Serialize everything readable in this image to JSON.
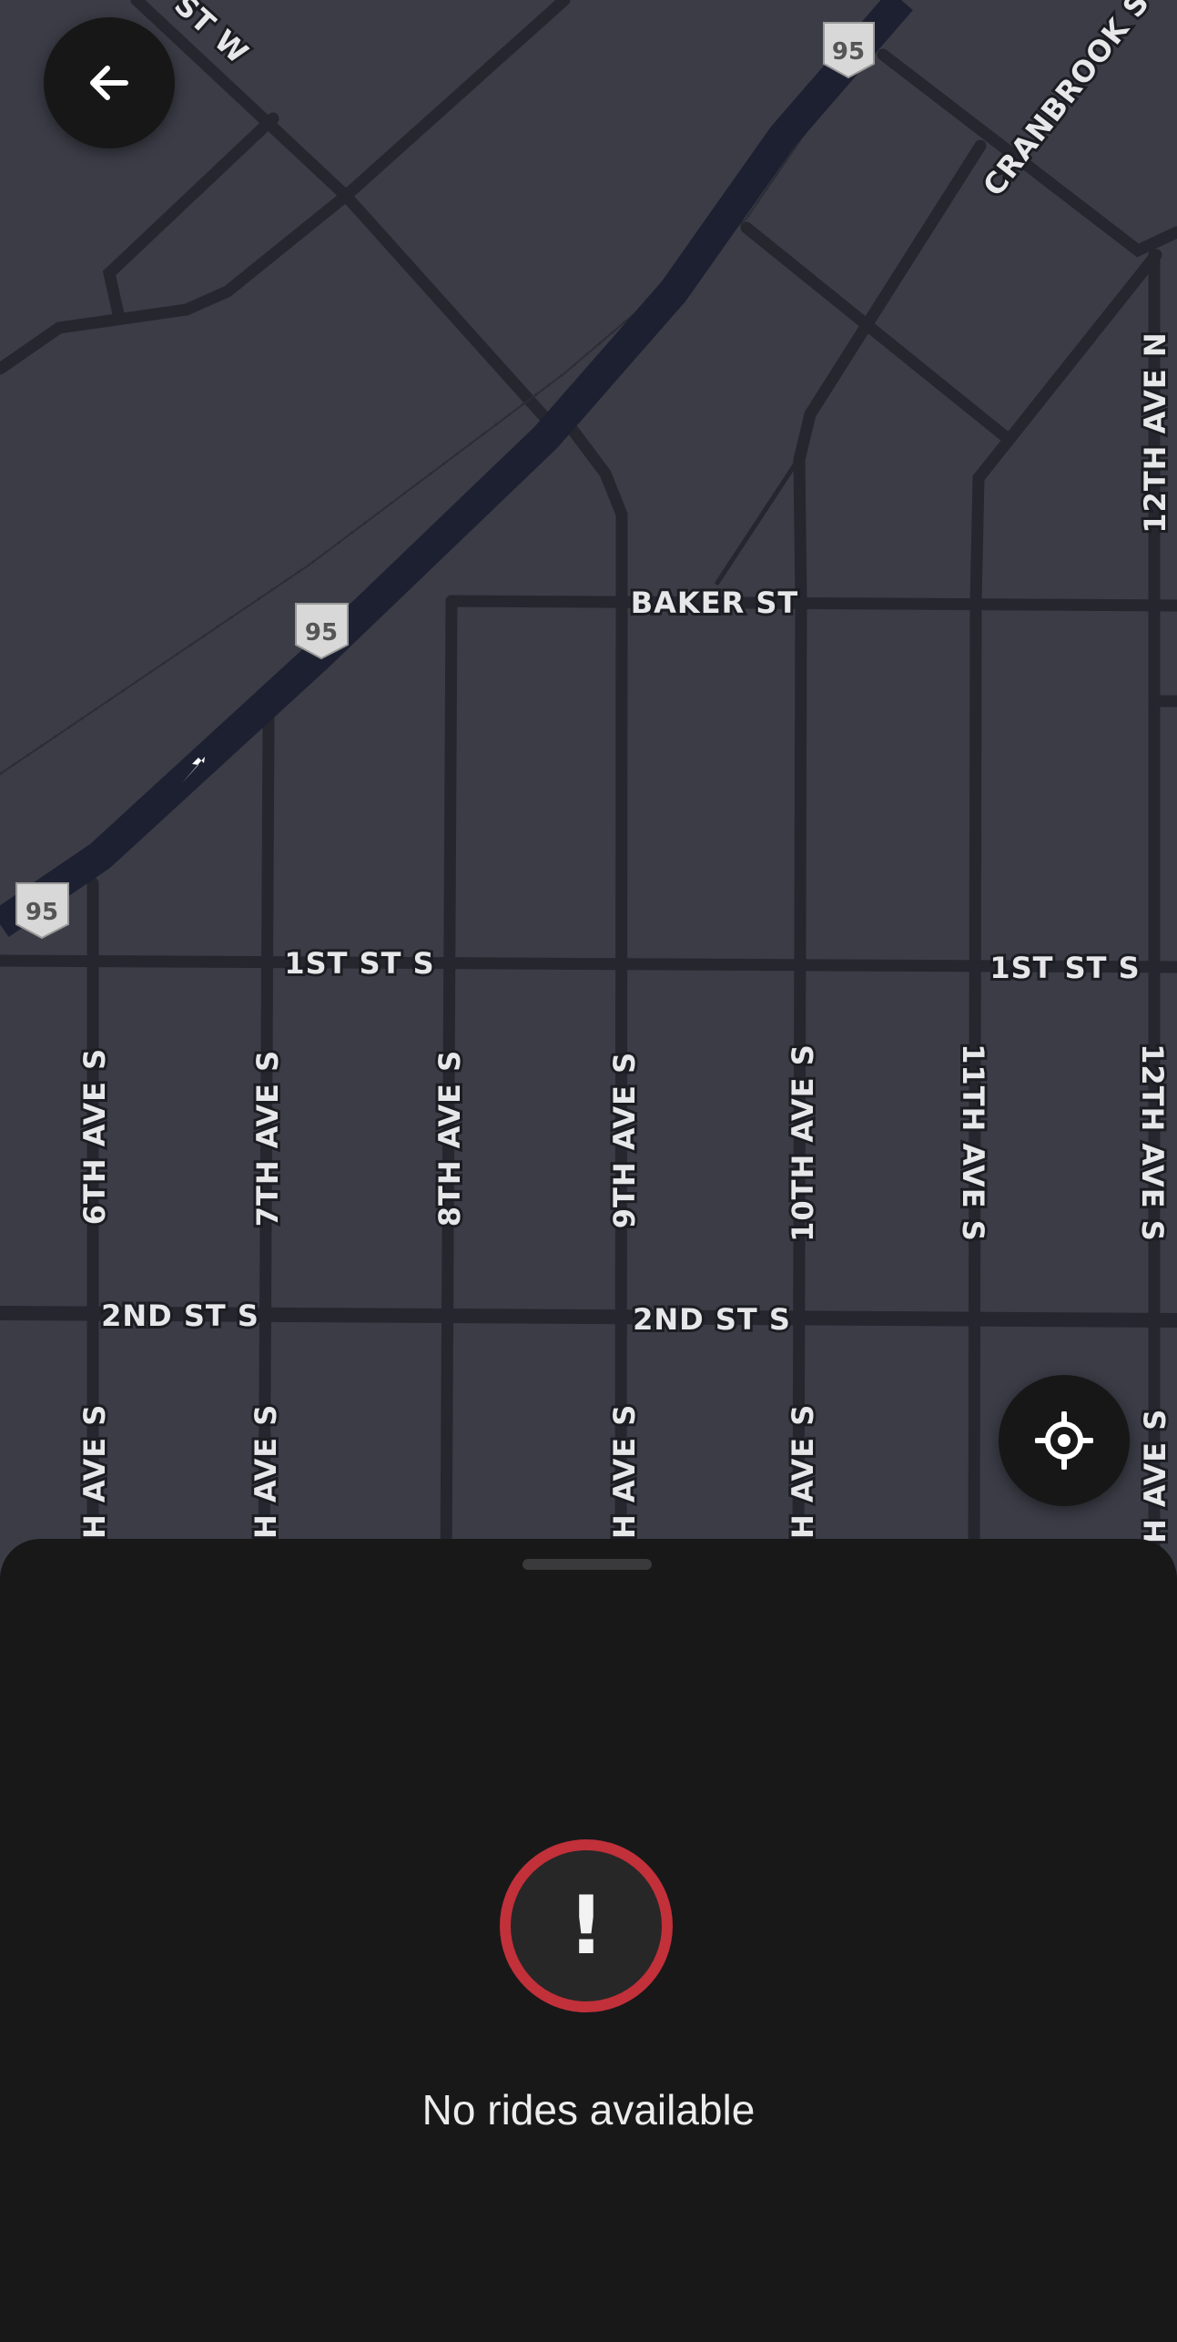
{
  "map": {
    "streets": {
      "st_w": "ST W",
      "cranbrook": "CRANBROOK S",
      "twelfth_ave_n": "12TH AVE N",
      "baker_st": "BAKER ST",
      "first_st_s_left": "1ST ST S",
      "first_st_s_right": "1ST ST S",
      "second_st_s_left": "2ND ST S",
      "second_st_s_right": "2ND ST S",
      "sixth_ave_s": "6TH AVE S",
      "seventh_ave_s": "7TH AVE S",
      "eighth_ave_s": "8TH AVE S",
      "ninth_ave_s": "9TH AVE S",
      "tenth_ave_s": "10TH AVE S",
      "eleventh_ave_s": "11TH AVE S",
      "twelfth_ave_s": "12TH AVE S",
      "lower_6": "H AVE S",
      "lower_7": "H AVE S",
      "lower_9": "H AVE S",
      "lower_10": "H AVE S",
      "lower_12": "H AVE S"
    },
    "highway_shields": [
      "95",
      "95",
      "95"
    ]
  },
  "controls": {
    "back_icon": "arrow-left-icon",
    "locate_icon": "crosshair-icon"
  },
  "sheet": {
    "alert_icon": "exclamation-icon",
    "alert_glyph": "!",
    "message": "No rides available"
  },
  "colors": {
    "map_background": "#3b3c46",
    "road": "#25262e",
    "highway": "#1c2030",
    "sheet_background": "#181819",
    "alert_ring": "#c2303a"
  }
}
